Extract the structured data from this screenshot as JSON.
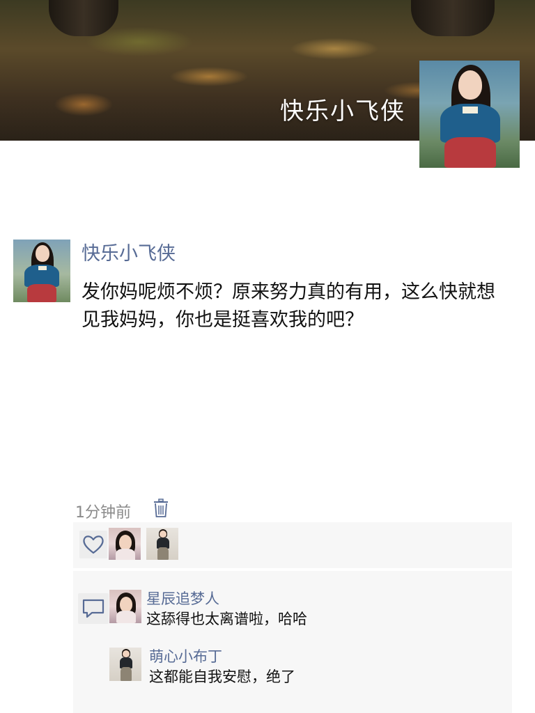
{
  "cover": {
    "title": "快乐小飞侠"
  },
  "post": {
    "author": "快乐小飞侠",
    "text": "发你妈呢烦不烦？原来努力真的有用，这么快就想见我妈妈，你也是挺喜欢我的吧？",
    "time": "1分钟前"
  },
  "comments": [
    {
      "author": "星辰追梦人",
      "text": "这舔得也太离谱啦，哈哈"
    },
    {
      "author": "萌心小布丁",
      "text": "这都能自我安慰，绝了"
    }
  ],
  "icons": {
    "delete": "trash-icon",
    "like": "heart-icon",
    "comment": "comment-icon"
  },
  "colors": {
    "name_link": "#576b95",
    "text": "#111111",
    "muted": "#8a8a8a",
    "panel": "#f7f7f7"
  }
}
